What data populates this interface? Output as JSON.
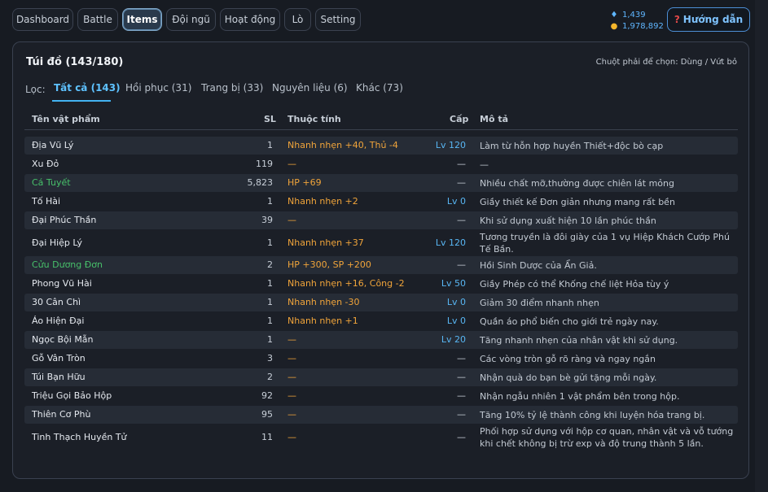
{
  "nav": {
    "tabs": [
      "Dashboard",
      "Battle",
      "Items",
      "Đội ngũ",
      "Hoạt động",
      "Lò",
      "Setting"
    ],
    "active": "Items"
  },
  "currency": {
    "gems": "1,439",
    "gold": "1,978,892"
  },
  "help_button": {
    "icon": "question-icon",
    "label": "Hướng dẫn"
  },
  "panel": {
    "title": "Túi đồ (143/180)",
    "hint": "Chuột phải để chọn: Dùng / Vứt bỏ",
    "filter_label": "Lọc:",
    "filters": [
      "Tất cả (143)",
      "Hồi phục (31)",
      "Trang bị (33)",
      "Nguyên liệu (6)",
      "Khác (73)"
    ],
    "active_filter": "Tất cả (143)",
    "columns": {
      "name": "Tên vật phẩm",
      "qty": "SL",
      "attr": "Thuộc tính",
      "level": "Cấp",
      "desc": "Mô tả"
    },
    "rows": [
      {
        "name": "Địa Vũ Lý",
        "green": false,
        "qty": "1",
        "attr": "Nhanh nhẹn +40, Thủ -4",
        "level": "Lv 120",
        "desc": "Làm từ hỗn hợp huyền Thiết+độc bò cạp"
      },
      {
        "name": "Xu Đỏ",
        "green": false,
        "qty": "119",
        "attr": "—",
        "level": "—",
        "desc": "—"
      },
      {
        "name": "Cá Tuyết",
        "green": true,
        "qty": "5,823",
        "attr": "HP +69",
        "level": "—",
        "desc": "Nhiều chất mỡ,thường được chiên lát mỏng"
      },
      {
        "name": "Tố Hài",
        "green": false,
        "qty": "1",
        "attr": "Nhanh nhẹn +2",
        "level": "Lv 0",
        "desc": "Giầy thiết kế Đơn giản nhưng mang rất bền"
      },
      {
        "name": "Đại Phúc Thần",
        "green": false,
        "qty": "39",
        "attr": "—",
        "level": "—",
        "desc": "Khi sử dụng xuất hiện 10 lần phúc thần"
      },
      {
        "name": "Đại Hiệp Lý",
        "green": false,
        "qty": "1",
        "attr": "Nhanh nhẹn +37",
        "level": "Lv 120",
        "desc": "Tương truyền là đôi giày của 1 vụ Hiệp Khách Cướp Phú Tế Bần."
      },
      {
        "name": "Cửu Dương Đơn",
        "green": true,
        "qty": "2",
        "attr": "HP +300, SP +200",
        "level": "—",
        "desc": "Hồi Sinh Dược của Ẩn Giả."
      },
      {
        "name": "Phong Vũ Hài",
        "green": false,
        "qty": "1",
        "attr": "Nhanh nhẹn +16, Công -2",
        "level": "Lv 50",
        "desc": "Giầy Phép có thể Khống chế liệt Hỏa tùy ý"
      },
      {
        "name": "30 Cân Chì",
        "green": false,
        "qty": "1",
        "attr": "Nhanh nhẹn -30",
        "level": "Lv 0",
        "desc": "Giảm 30 điểm nhanh nhẹn"
      },
      {
        "name": "Áo Hiện Đại",
        "green": false,
        "qty": "1",
        "attr": "Nhanh nhẹn +1",
        "level": "Lv 0",
        "desc": "Quần áo phổ biến cho giới trẻ ngày nay."
      },
      {
        "name": "Ngọc Bội Mẫn",
        "green": false,
        "qty": "1",
        "attr": "—",
        "level": "Lv 20",
        "desc": "Tăng nhanh nhẹn của nhân vật khi sử dụng."
      },
      {
        "name": "Gỗ Vân Tròn",
        "green": false,
        "qty": "3",
        "attr": "—",
        "level": "—",
        "desc": "Các vòng tròn gỗ rõ ràng và ngay ngắn"
      },
      {
        "name": "Túi Bạn Hữu",
        "green": false,
        "qty": "2",
        "attr": "—",
        "level": "—",
        "desc": "Nhận quà do bạn bè gửi tặng mỗi ngày."
      },
      {
        "name": "Triệu Gọi Bảo Hộp",
        "green": false,
        "qty": "92",
        "attr": "—",
        "level": "—",
        "desc": "Nhận ngẫu nhiên 1 vật phẩm bên trong hộp."
      },
      {
        "name": "Thiên Cơ Phù",
        "green": false,
        "qty": "95",
        "attr": "—",
        "level": "—",
        "desc": "Tăng 10% tỷ lệ thành công khi luyện hóa trang bị."
      },
      {
        "name": "Tinh Thạch Huyền Tử",
        "green": false,
        "qty": "11",
        "attr": "—",
        "level": "—",
        "desc": "Phối hợp sử dụng với hộp cơ quan, nhân vật và vỗ tướng khi chết không bị trừ exp và độ trung thành 5 lần."
      }
    ]
  },
  "colors": {
    "accent": "#43b3f2",
    "green_item": "#47c06a",
    "attr": "#f0a43a",
    "level": "#58b6f3"
  }
}
